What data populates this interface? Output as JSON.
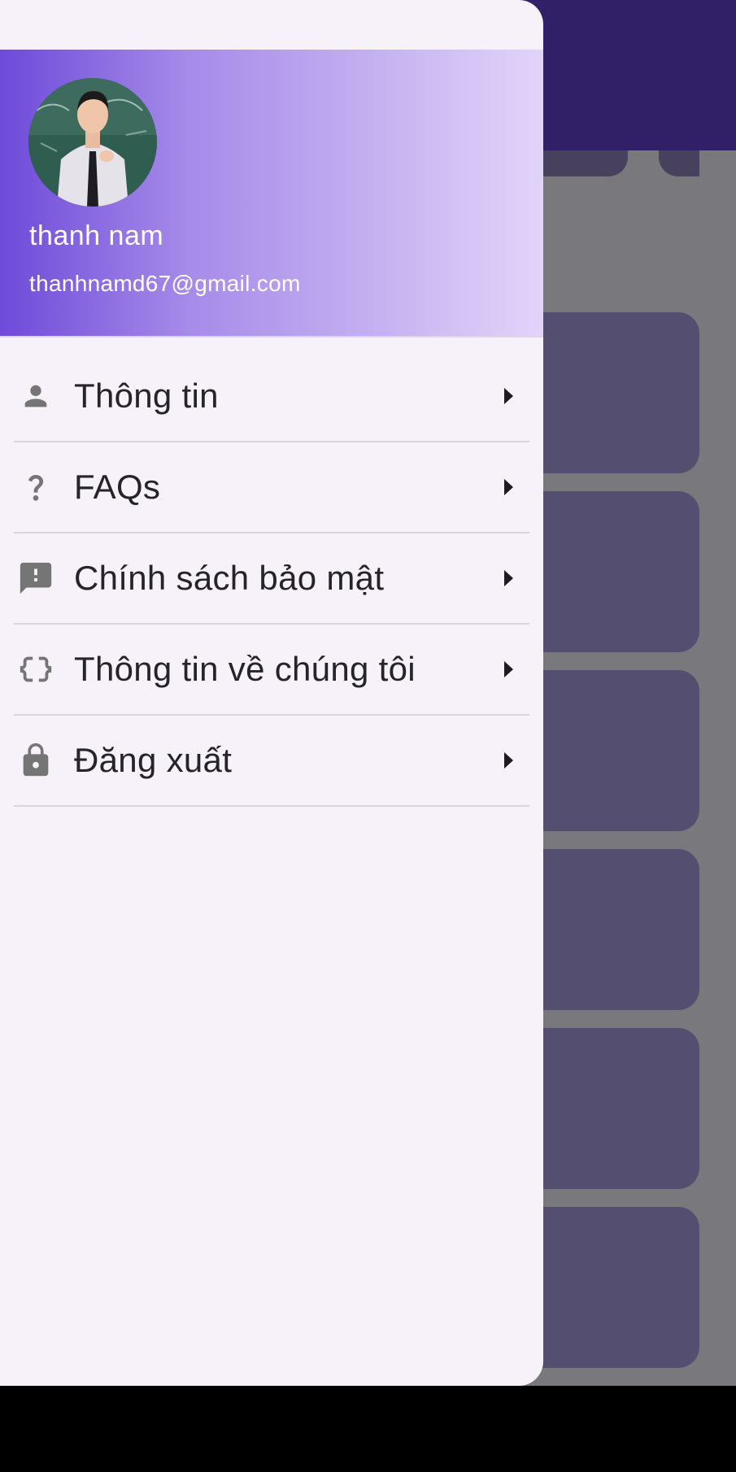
{
  "user": {
    "name": "thanh nam",
    "email": "thanhnamd67@gmail.com"
  },
  "menu": {
    "items": [
      {
        "label": "Thông tin",
        "icon": "person-icon"
      },
      {
        "label": "FAQs",
        "icon": "question-mark-icon"
      },
      {
        "label": "Chính sách bảo mật",
        "icon": "feedback-icon"
      },
      {
        "label": "Thông tin về chúng tôi",
        "icon": "data-object-icon"
      },
      {
        "label": "Đăng xuất",
        "icon": "lock-icon"
      }
    ]
  },
  "colors": {
    "app_bar": "#312068",
    "header_gradient_start": "#6e4ad9",
    "header_gradient_end": "#e2d4f9",
    "drawer_background": "#f7f2f9",
    "icon_color": "#757575"
  }
}
